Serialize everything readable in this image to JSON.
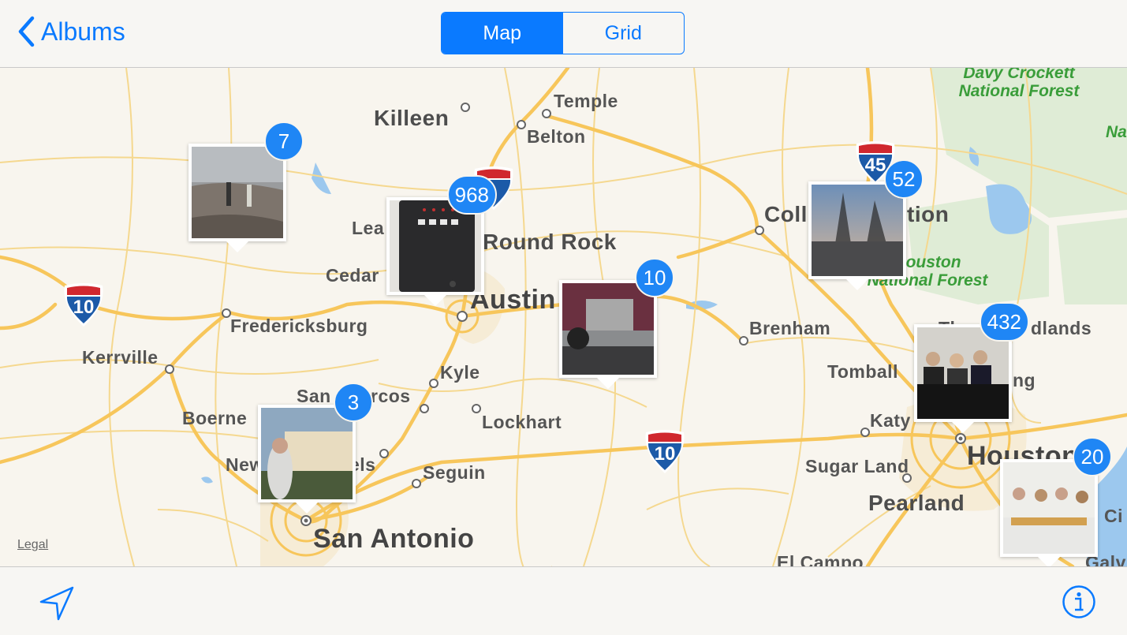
{
  "navbar": {
    "back_label": "Albums",
    "segments": [
      "Map",
      "Grid"
    ],
    "selected_segment": "Map"
  },
  "map": {
    "cities": {
      "killeen": "Killeen",
      "temple": "Temple",
      "belton": "Belton",
      "round_rock": "Round Rock",
      "leander": "Lea",
      "cedar_park": "Cedar",
      "austin": "Austin",
      "fredericksburg": "Fredericksburg",
      "kerrville": "Kerrville",
      "kyle": "Kyle",
      "san_marcos_a": "San",
      "san_marcos_b": "rcos",
      "lockhart": "Lockhart",
      "boerne": "Boerne",
      "new_braunfels_a": "New",
      "new_braunfels_b": "els",
      "seguin": "Seguin",
      "san_antonio": "San Antonio",
      "college_station_a": "Coll",
      "college_station_b": "tion",
      "brenham": "Brenham",
      "woodlands_a": "Th",
      "woodlands_b": "dlands",
      "tomball": "Tomball",
      "katy": "Katy",
      "spring": "ng",
      "sugar_land": "Sugar Land",
      "pearland": "Pearland",
      "houston": "Houston",
      "el_campo": "El Campo",
      "galveston": "Galv",
      "city_partial": "Ci"
    },
    "forests": {
      "davy_crockett": "Davy Crockett\nNational Forest",
      "sam_houston": "Houston\nNational Forest",
      "angelina": "Na"
    },
    "highways": {
      "i10": "10",
      "i45": "45",
      "i35": "35"
    },
    "legal": "Legal"
  },
  "pins": [
    {
      "id": "pin-7",
      "count": "7",
      "icon": "photo-rocks"
    },
    {
      "id": "pin-968",
      "count": "968",
      "icon": "photo-device"
    },
    {
      "id": "pin-10",
      "count": "10",
      "icon": "photo-truck"
    },
    {
      "id": "pin-52",
      "count": "52",
      "icon": "photo-trees"
    },
    {
      "id": "pin-432",
      "count": "432",
      "icon": "photo-panel"
    },
    {
      "id": "pin-3",
      "count": "3",
      "icon": "photo-alamo"
    },
    {
      "id": "pin-20",
      "count": "20",
      "icon": "photo-group"
    }
  ],
  "toolbar": {
    "locate_icon": "location-arrow-icon",
    "info_icon": "info-icon"
  },
  "colors": {
    "accent": "#0a7aff",
    "badge": "#1f86f5",
    "forest": "#3a9d3a",
    "road": "#f7c65b",
    "water": "#9cc8ee"
  }
}
